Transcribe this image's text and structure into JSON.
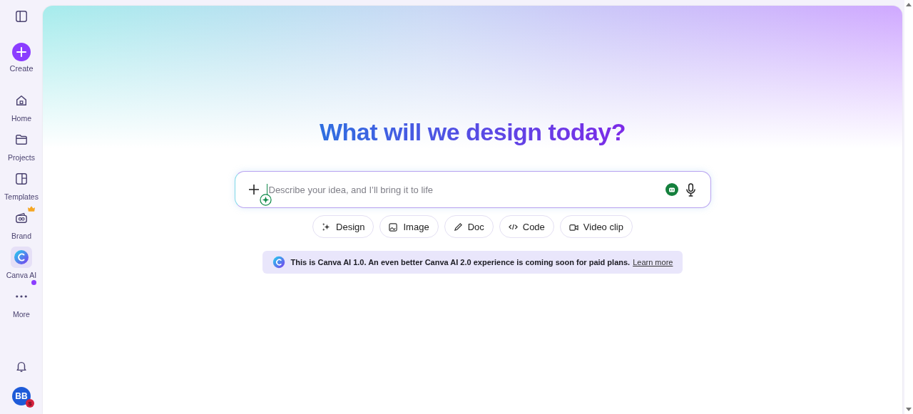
{
  "sidebar": {
    "create": {
      "label": "Create"
    },
    "items": [
      {
        "label": "Home",
        "selected": false
      },
      {
        "label": "Projects",
        "selected": false
      },
      {
        "label": "Templates",
        "selected": false
      },
      {
        "label": "Brand",
        "selected": false
      },
      {
        "label": "Canva AI",
        "selected": true
      },
      {
        "label": "More",
        "selected": false
      }
    ],
    "avatar": {
      "initials": "BB",
      "badge": "S"
    }
  },
  "main": {
    "heading": "What will we design today?",
    "prompt": {
      "placeholder": "Describe your idea, and I’ll bring it to life"
    },
    "chips": [
      {
        "label": "Design"
      },
      {
        "label": "Image"
      },
      {
        "label": "Doc"
      },
      {
        "label": "Code"
      },
      {
        "label": "Video clip"
      }
    ],
    "notice": {
      "text": "**This is Canva AI 1.0. An even better Canva AI 2.0 experience is coming soon for paid plans.**",
      "link": "Learn more"
    }
  }
}
